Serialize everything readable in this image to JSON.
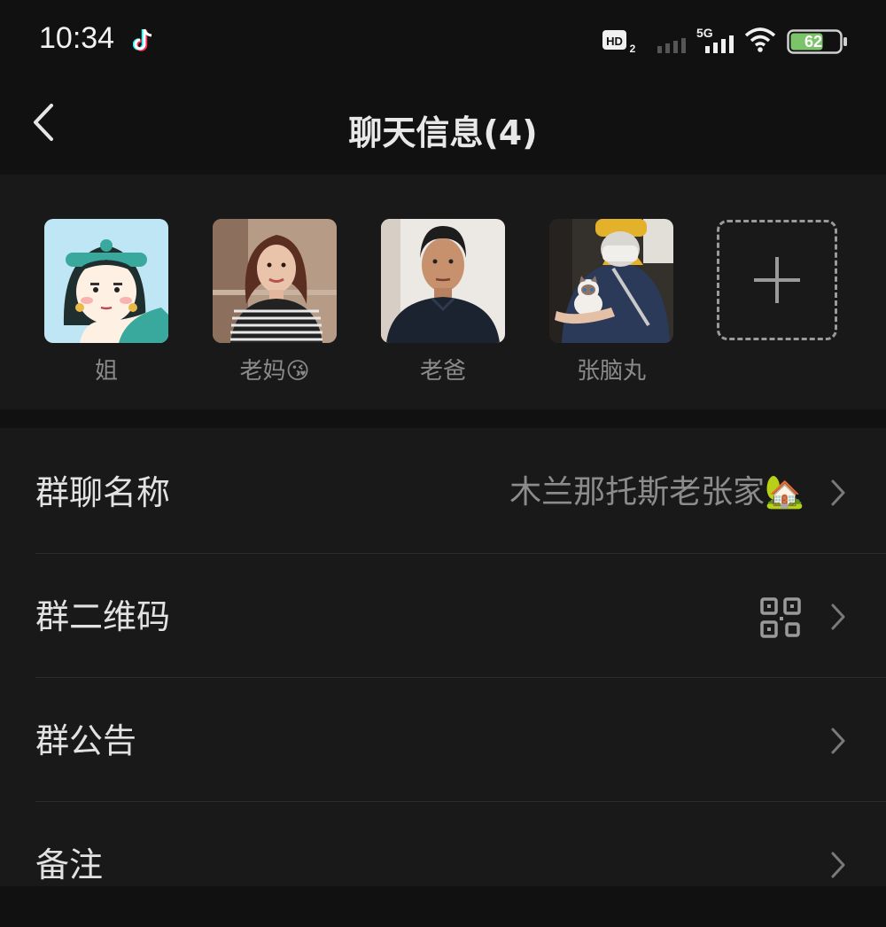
{
  "status_bar": {
    "time": "10:34",
    "network_label": "5G",
    "hd_label": "HD",
    "hd_sub": "2",
    "battery": "62"
  },
  "header": {
    "title": "聊天信息(4)"
  },
  "members": [
    {
      "name": "姐"
    },
    {
      "name": "老妈😘"
    },
    {
      "name": "老爸"
    },
    {
      "name": "张脑丸"
    }
  ],
  "settings": {
    "group_name_label": "群聊名称",
    "group_name_value": "木兰那托斯老张家🏡",
    "qr_label": "群二维码",
    "notice_label": "群公告",
    "remark_label": "备注"
  },
  "colors": {
    "background": "#111111",
    "panel": "#191919",
    "battery_fill": "#7cc46a"
  }
}
